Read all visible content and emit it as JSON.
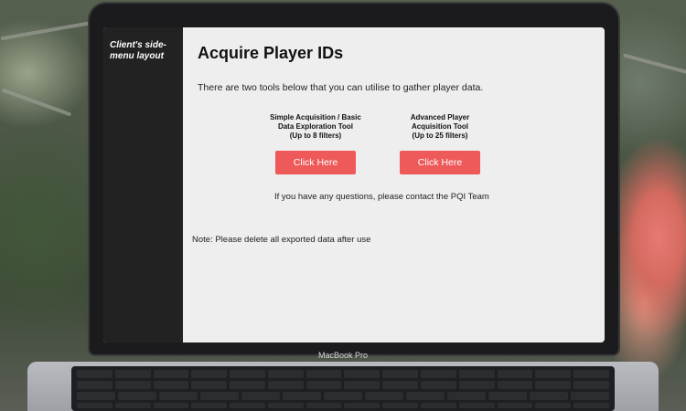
{
  "side_menu": {
    "label": "Client's side-menu layout"
  },
  "page": {
    "title": "Acquire Player IDs",
    "intro": "There are two tools below that you can utilise to gather player data."
  },
  "tools": [
    {
      "line1": "Simple Acquisition / Basic",
      "line2": "Data Exploration Tool",
      "line3": "(Up to 8 filters)",
      "button_label": "Click Here"
    },
    {
      "line1": "Advanced Player",
      "line2": "Acquisition Tool",
      "line3": "(Up to 25 filters)",
      "button_label": "Click Here"
    }
  ],
  "contact": "If you have any questions, please contact the PQI Team",
  "note": "Note: Please delete all exported data after use",
  "device": {
    "label": "MacBook Pro"
  },
  "colors": {
    "button": "#ee5a5a",
    "side_menu": "#222222",
    "content_background": "#eeeeee"
  }
}
